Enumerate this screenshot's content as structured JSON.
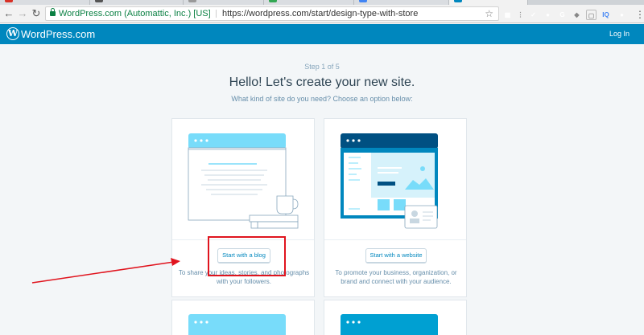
{
  "browser": {
    "address": {
      "secure_label": "WordPress.com (Automattic, Inc.) [US]",
      "url": "https://wordpress.com/start/design-type-with-store"
    },
    "extensions": [
      {
        "name": "puzzle-extension-icon",
        "color": "#3b5998",
        "glyph": "▦"
      },
      {
        "name": "checkmark-extension-icon",
        "color": "#4a4a4a",
        "glyph": "✓"
      },
      {
        "name": "rec-extension-icon",
        "color": "#7b1f1f",
        "glyph": "●"
      },
      {
        "name": "grammarly-extension-icon",
        "color": "#15c39a",
        "glyph": "G"
      },
      {
        "name": "cat-extension-icon",
        "color": "#888888",
        "glyph": "◆"
      },
      {
        "name": "frame-extension-icon",
        "color": "#bbbbbb",
        "glyph": "▢"
      },
      {
        "name": "iq-extension-icon",
        "color": "#4285f4",
        "glyph": "IQ"
      },
      {
        "name": "cookie-extension-icon",
        "color": "#f5a623",
        "glyph": "●"
      }
    ]
  },
  "masterbar": {
    "site_name": "WordPress.com",
    "login_label": "Log In"
  },
  "signup": {
    "step_label": "Step 1 of 5",
    "headline": "Hello! Let's create your new site.",
    "subhead": "What kind of site do you need? Choose an option below:"
  },
  "cards": {
    "blog": {
      "button_label": "Start with a blog",
      "description_line1": "To share your ideas, stories, and photographs",
      "description_line2": "with your followers."
    },
    "website": {
      "button_label": "Start with a website",
      "description_line1": "To promote your business, organization, or",
      "description_line2": "brand and connect with your audience."
    }
  },
  "colors": {
    "wp_blue": "#0087be",
    "illustration_light_blue": "#78dcfa",
    "illustration_dark_blue": "#0087be",
    "annotation_red": "#e0141e"
  }
}
